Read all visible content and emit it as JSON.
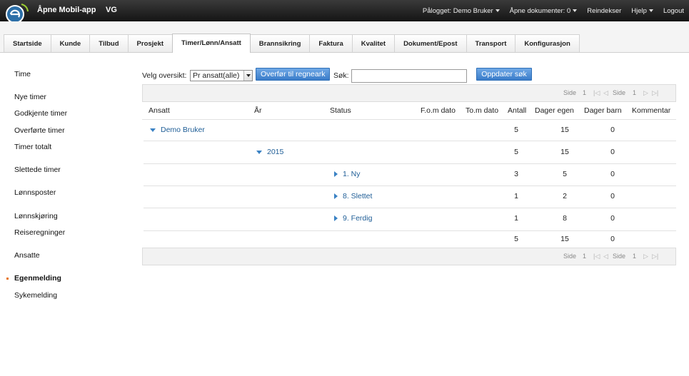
{
  "app": {
    "title": "Åpne Mobil-app",
    "org": "VG",
    "logo_icon": "e-logo-icon"
  },
  "topmenu": {
    "logged_in": "Pålogget: Demo Bruker",
    "open_docs": "Åpne dokumenter: 0",
    "reindex": "Reindekser",
    "help": "Hjelp",
    "logout": "Logout"
  },
  "tabs": [
    {
      "label": "Startside"
    },
    {
      "label": "Kunde"
    },
    {
      "label": "Tilbud"
    },
    {
      "label": "Prosjekt"
    },
    {
      "label": "Timer/Lønn/Ansatt",
      "active": true
    },
    {
      "label": "Brannsikring"
    },
    {
      "label": "Faktura"
    },
    {
      "label": "Kvalitet"
    },
    {
      "label": "Dokument/Epost"
    },
    {
      "label": "Transport"
    },
    {
      "label": "Konfigurasjon"
    }
  ],
  "sidebar": {
    "items": [
      {
        "label": "Time"
      },
      {
        "label": "Nye timer"
      },
      {
        "label": "Godkjente timer"
      },
      {
        "label": "Overførte timer"
      },
      {
        "label": "Timer totalt"
      },
      {
        "label": "Slettede timer"
      },
      {
        "label": "Lønnsposter"
      },
      {
        "label": "Lønnskjøring"
      },
      {
        "label": "Reiseregninger"
      },
      {
        "label": "Ansatte"
      },
      {
        "label": "Egenmelding",
        "active": true
      },
      {
        "label": "Sykemelding"
      }
    ]
  },
  "toolbar": {
    "view_label": "Velg oversikt:",
    "view_value": "Pr ansatt(alle)",
    "transfer_button": "Overfør til regneark",
    "search_label": "Søk:",
    "search_value": "",
    "update_button": "Oppdater søk"
  },
  "pager": {
    "side_label": "Side",
    "page": "1",
    "total_pages": "1"
  },
  "grid": {
    "columns": [
      "Ansatt",
      "År",
      "Status",
      "F.o.m dato",
      "To.m dato",
      "Antall",
      "Dager egen",
      "Dager barn",
      "Kommentar"
    ],
    "rows": [
      {
        "level": 0,
        "label": "Demo Bruker",
        "expanded": true,
        "antall": "5",
        "dager_egen": "15",
        "dager_barn": "0"
      },
      {
        "level": 1,
        "label": "2015",
        "expanded": true,
        "antall": "5",
        "dager_egen": "15",
        "dager_barn": "0"
      },
      {
        "level": 2,
        "label": "1. Ny",
        "expanded": false,
        "antall": "3",
        "dager_egen": "5",
        "dager_barn": "0"
      },
      {
        "level": 2,
        "label": "8. Slettet",
        "expanded": false,
        "antall": "1",
        "dager_egen": "2",
        "dager_barn": "0"
      },
      {
        "level": 2,
        "label": "9. Ferdig",
        "expanded": false,
        "antall": "1",
        "dager_egen": "8",
        "dager_barn": "0"
      }
    ],
    "totals": {
      "antall": "5",
      "dager_egen": "15",
      "dager_barn": "0"
    }
  },
  "colors": {
    "accent": "#3a7cc9",
    "link": "#1e5d96",
    "active_marker": "#e8761d"
  }
}
